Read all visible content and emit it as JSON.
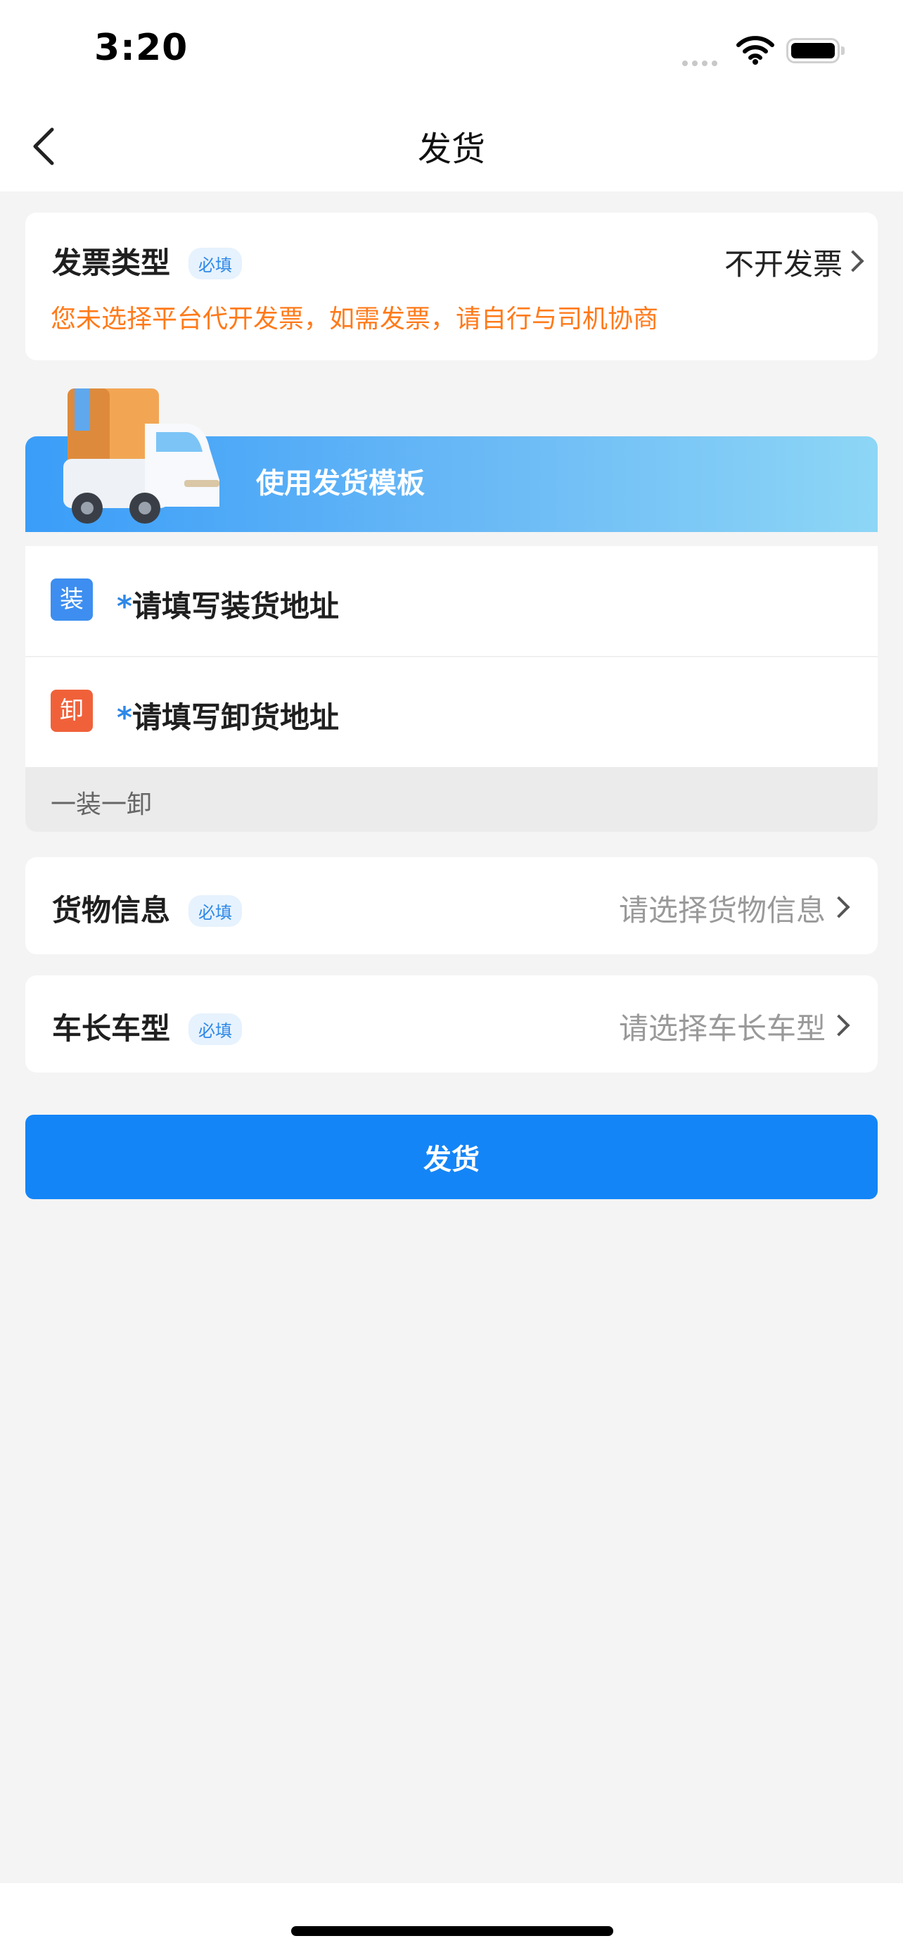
{
  "status_bar": {
    "time": "3:20"
  },
  "nav": {
    "title": "发货"
  },
  "invoice": {
    "label": "发票类型",
    "required_tag": "必填",
    "value": "不开发票",
    "note": "您未选择平台代开发票，如需发票，请自行与司机协商"
  },
  "template_banner": {
    "label": "使用发货模板"
  },
  "address": {
    "load_tag": "装",
    "load_placeholder": "请填写装货地址",
    "unload_tag": "卸",
    "unload_placeholder": "请填写卸货地址",
    "required_mark": "*",
    "mode": "一装一卸"
  },
  "goods": {
    "label": "货物信息",
    "required_tag": "必填",
    "placeholder": "请选择货物信息"
  },
  "vehicle": {
    "label": "车长车型",
    "required_tag": "必填",
    "placeholder": "请选择车长车型"
  },
  "submit": {
    "label": "发货"
  },
  "colors": {
    "primary": "#1485f7",
    "warning_text": "#ff7a1a",
    "load_tag": "#3d8ef0",
    "unload_tag": "#f0613a"
  }
}
